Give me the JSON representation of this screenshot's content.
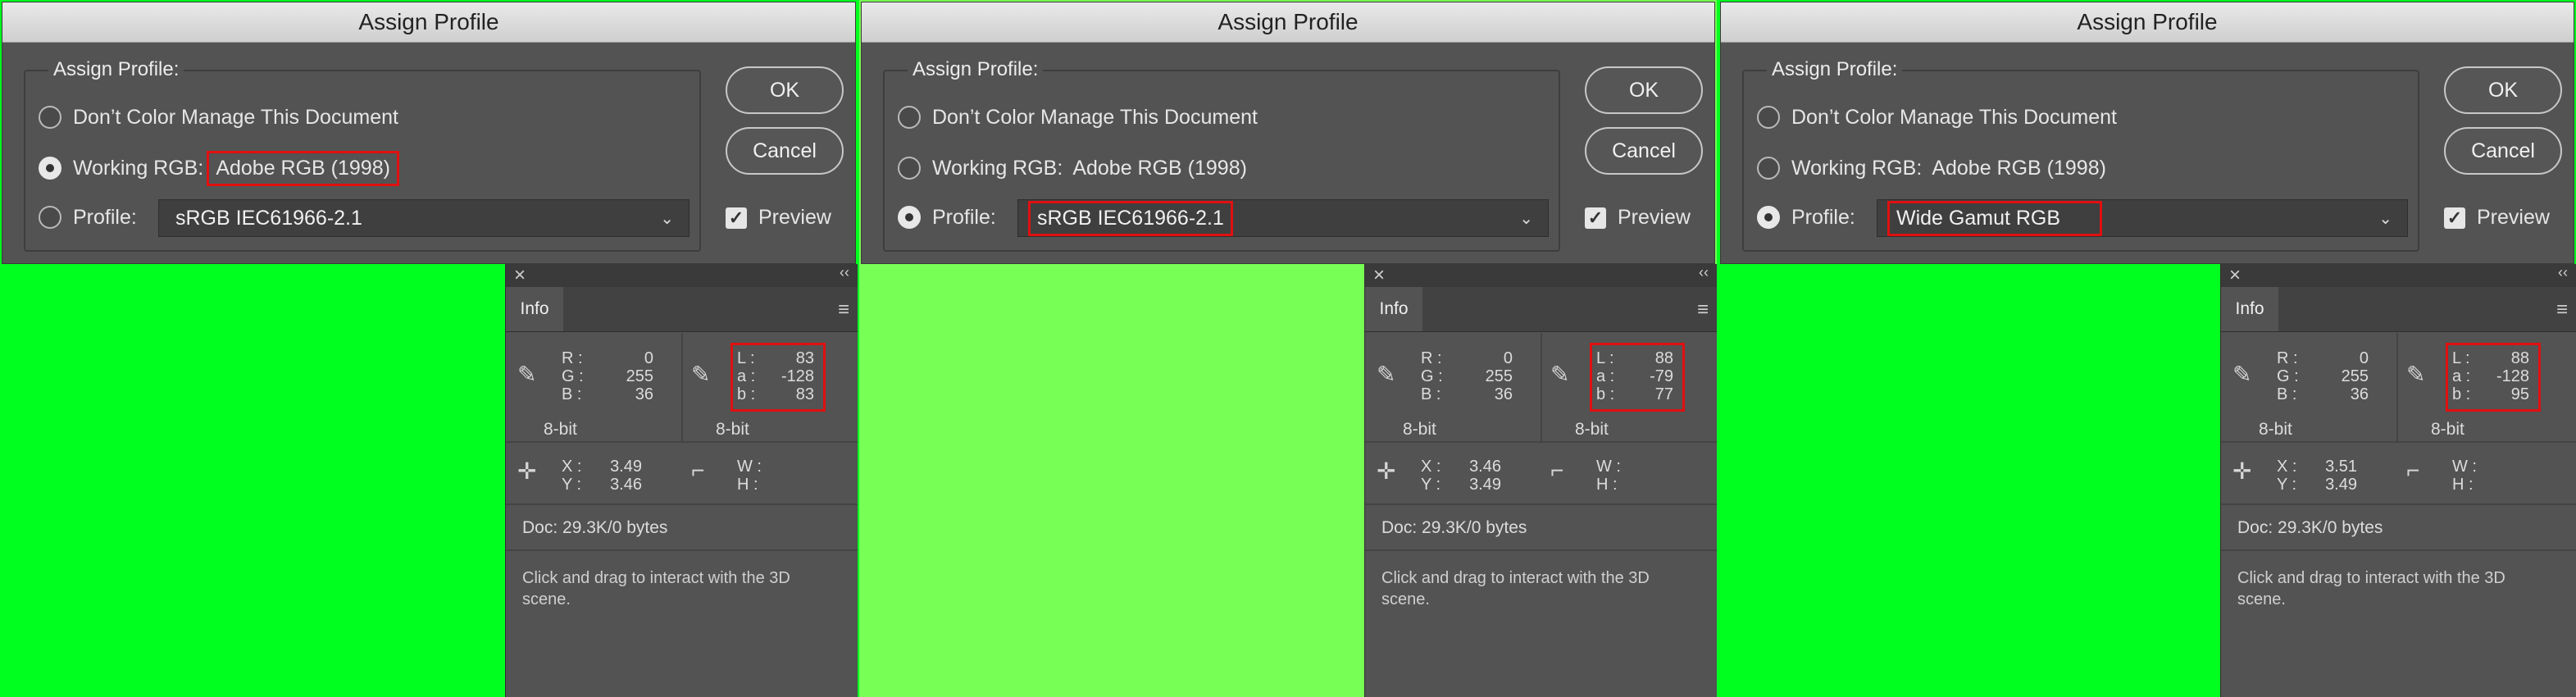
{
  "colors": {
    "green_bright": "#00ff1e",
    "green_light": "#77ff55",
    "highlight": "#e01010"
  },
  "panels": [
    {
      "dialog": {
        "title": "Assign Profile",
        "group_label": "Assign Profile:",
        "opt1": "Don’t Color Manage This Document",
        "opt2_label": "Working RGB:",
        "opt2_value": "Adobe RGB (1998)",
        "opt3_label": "Profile:",
        "profile_value": "sRGB IEC61966-2.1",
        "ok": "OK",
        "cancel": "Cancel",
        "preview": "Preview",
        "selected": "working"
      },
      "info": {
        "tab": "Info",
        "R": "0",
        "G": "255",
        "B": "36",
        "L": "83",
        "a": "-128",
        "b": "83",
        "bit1": "8-bit",
        "bit2": "8-bit",
        "X": "3.49",
        "Y": "3.46",
        "W": "",
        "H": "",
        "doc": "Doc: 29.3K/0 bytes",
        "hint": "Click and drag to interact with the 3D scene."
      }
    },
    {
      "dialog": {
        "title": "Assign Profile",
        "group_label": "Assign Profile:",
        "opt1": "Don’t Color Manage This Document",
        "opt2_label": "Working RGB:",
        "opt2_value": "Adobe RGB (1998)",
        "opt3_label": "Profile:",
        "profile_value": "sRGB IEC61966-2.1",
        "ok": "OK",
        "cancel": "Cancel",
        "preview": "Preview",
        "selected": "profile"
      },
      "info": {
        "tab": "Info",
        "R": "0",
        "G": "255",
        "B": "36",
        "L": "88",
        "a": "-79",
        "b": "77",
        "bit1": "8-bit",
        "bit2": "8-bit",
        "X": "3.46",
        "Y": "3.49",
        "W": "",
        "H": "",
        "doc": "Doc: 29.3K/0 bytes",
        "hint": "Click and drag to interact with the 3D scene."
      }
    },
    {
      "dialog": {
        "title": "Assign Profile",
        "group_label": "Assign Profile:",
        "opt1": "Don’t Color Manage This Document",
        "opt2_label": "Working RGB:",
        "opt2_value": "Adobe RGB (1998)",
        "opt3_label": "Profile:",
        "profile_value": "Wide Gamut RGB",
        "ok": "OK",
        "cancel": "Cancel",
        "preview": "Preview",
        "selected": "profile"
      },
      "info": {
        "tab": "Info",
        "R": "0",
        "G": "255",
        "B": "36",
        "L": "88",
        "a": "-128",
        "b": "95",
        "bit1": "8-bit",
        "bit2": "8-bit",
        "X": "3.51",
        "Y": "3.49",
        "W": "",
        "H": "",
        "doc": "Doc: 29.3K/0 bytes",
        "hint": "Click and drag to interact with the 3D scene."
      }
    }
  ]
}
